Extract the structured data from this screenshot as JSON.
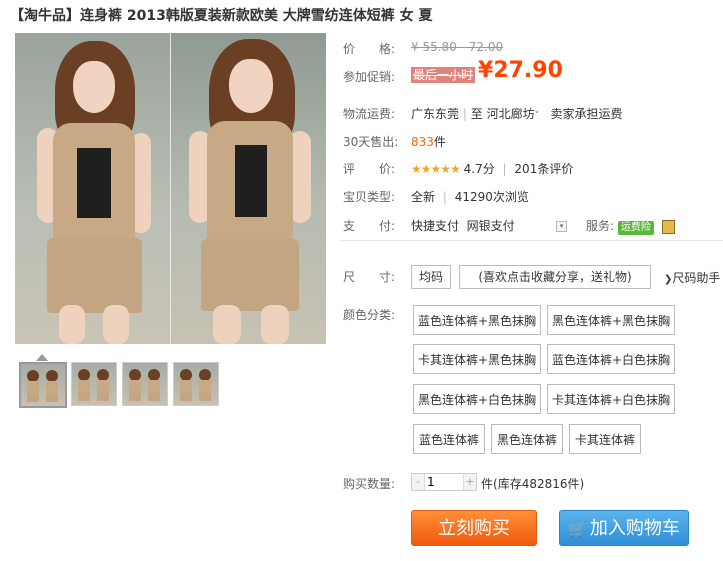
{
  "title": {
    "bracket_brand": "【淘牛品】",
    "name": "连身裤 2013韩版夏装新款欧美 大牌雪纺连体短裤 女 夏"
  },
  "price": {
    "label": "价　　格:",
    "original": "¥ 55.80 - 72.00"
  },
  "promo": {
    "label": "参加促销:",
    "badge": "最后一小时",
    "currency": "¥",
    "amount": "27.90"
  },
  "shipping": {
    "label": "物流运费:",
    "from": "广东东莞",
    "sep": "|",
    "to_prefix": "至",
    "to": "河北廊坊",
    "caret": "˅",
    "fee": "卖家承担运费"
  },
  "sales": {
    "label": "30天售出:",
    "count": "833",
    "unit": "件"
  },
  "rating": {
    "label": "评　　价:",
    "stars": "★★★★★",
    "score": "4.7分",
    "sep": "|",
    "reviews": "201条评价"
  },
  "item_type": {
    "label": "宝贝类型:",
    "condition": "全新",
    "sep": "|",
    "views": "41290次浏览"
  },
  "payment": {
    "label": "支　　付:",
    "methods": [
      "快捷支付",
      "网银支付"
    ],
    "service_label": "服务:",
    "service_badge": "运费险"
  },
  "size": {
    "label": "尺　　寸:",
    "option": "均码",
    "promo_note": "(喜欢点击收藏分享，送礼物)",
    "guide": "尺码助手"
  },
  "color": {
    "label": "颜色分类:",
    "options": [
      "蓝色连体裤+黑色抹胸",
      "黑色连体裤+黑色抹胸",
      "卡其连体裤+黑色抹胸",
      "蓝色连体裤+白色抹胸",
      "黑色连体裤+白色抹胸",
      "卡其连体裤+白色抹胸",
      "蓝色连体裤",
      "黑色连体裤",
      "卡其连体裤"
    ]
  },
  "quantity": {
    "label": "购买数量:",
    "minus": "-",
    "value": "1",
    "plus": "+",
    "unit": "件",
    "stock": "(库存482816件)"
  },
  "actions": {
    "buy": "立刻购买",
    "cart_icon": "🛒",
    "cart": "加入购物车"
  },
  "thumbnails": {
    "count": 4,
    "active_index": 0
  },
  "colors": {
    "accent": "#ff4400",
    "buy": "#f05a0c",
    "cart": "#2f8fd6",
    "service_badge": "#5ab73d"
  }
}
